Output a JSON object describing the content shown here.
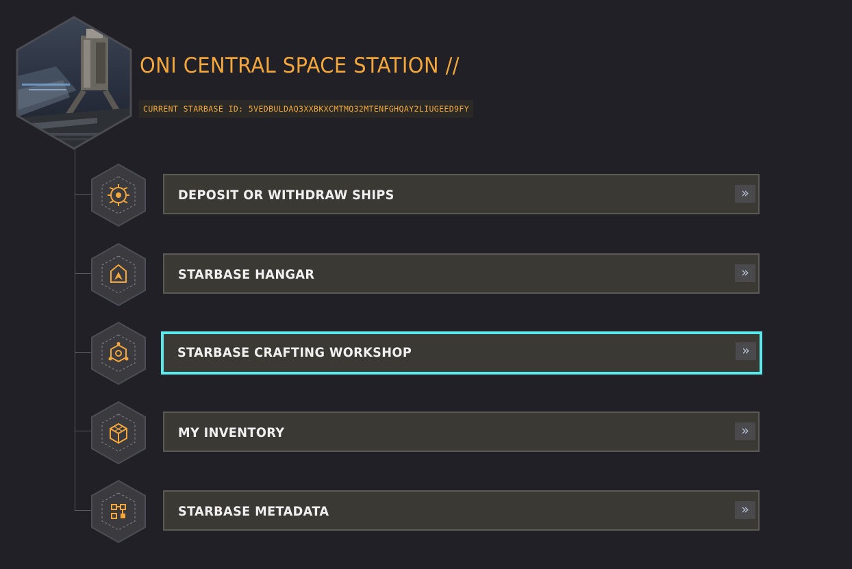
{
  "station": {
    "title": "ONI CENTRAL SPACE STATION //",
    "id_text": "CURRENT STARBASE ID: 5VEDBULDAQ3XXBKXCMTMQ32MTENFGHQAY2LIUGEED9FY",
    "image": "space-station-hangar-image"
  },
  "menu": [
    {
      "label": "DEPOSIT OR WITHDRAW SHIPS",
      "icon": "crosshair-ship-icon",
      "chevron": "»",
      "active": false
    },
    {
      "label": "STARBASE HANGAR",
      "icon": "hangar-ship-icon",
      "chevron": "»",
      "active": false
    },
    {
      "label": "STARBASE CRAFTING WORKSHOP",
      "icon": "crafting-network-icon",
      "chevron": "»",
      "active": true
    },
    {
      "label": "MY INVENTORY",
      "icon": "cube-inventory-icon",
      "chevron": "»",
      "active": false
    },
    {
      "label": "STARBASE METADATA",
      "icon": "metadata-grid-icon",
      "chevron": "»",
      "active": false
    }
  ],
  "colors": {
    "background": "#212027",
    "accent": "#f3a73c",
    "active_border": "#5ce9ec",
    "button_bg": "#3a3934",
    "button_border": "#5b5a55",
    "label": "#f0f0f0"
  }
}
